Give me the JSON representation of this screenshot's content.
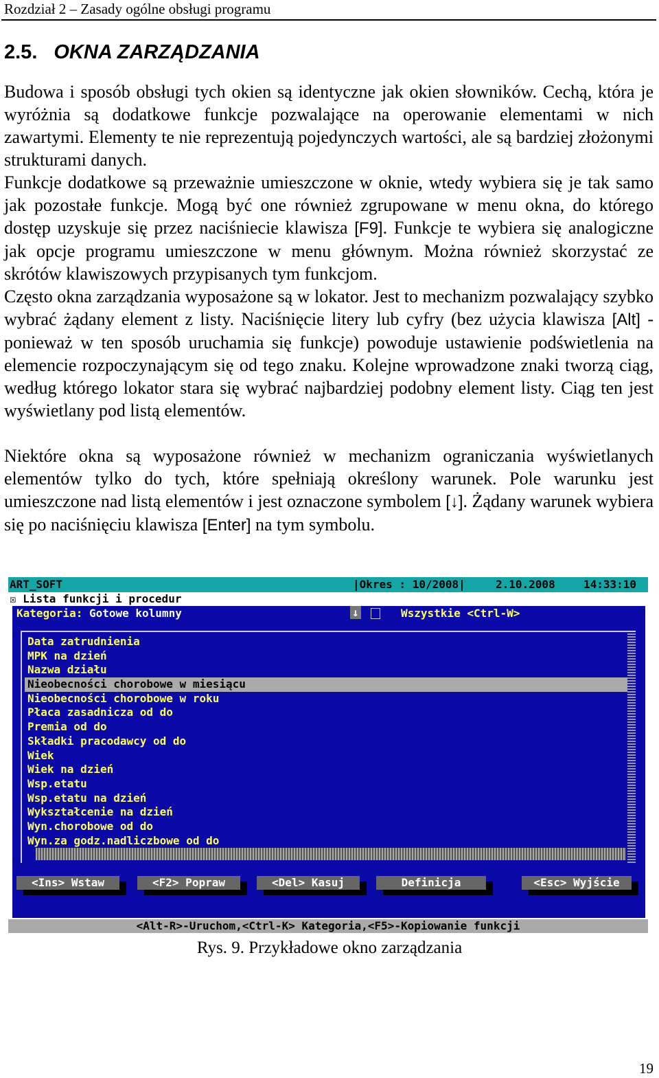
{
  "running_head": "Rozdział 2 – Zasady ogólne obsługi programu",
  "heading": {
    "number": "2.5.",
    "title": "OKNA ZARZĄDZANIA"
  },
  "paragraphs": [
    [
      {
        "t": "Budowa i sposób obsługi tych okien są identyczne jak okien słowników. Cechą, która je wyróżnia są dodatkowe funkcje pozwalające na operowanie elementami w nich zawartymi. Elementy te nie reprezentują pojedynczych wartości, ale są bardziej złożonymi strukturami danych."
      }
    ],
    [
      {
        "t": "Funkcje dodatkowe są przeważnie umieszczone w oknie, wtedy wybiera się je tak samo jak pozostałe funkcje. Mogą być one również zgrupowane w menu okna, do którego dostęp uzyskuje się przez naciśniecie klawisza "
      },
      {
        "k": "[F9]"
      },
      {
        "t": ". Funkcje te wybiera się analogiczne jak opcje programu umieszczone w menu głównym. Można również skorzystać ze skrótów klawiszowych przypisanych tym funkcjom."
      }
    ],
    [
      {
        "t": "Często okna zarządzania wyposażone są w lokator. Jest to mechanizm pozwalający szybko wybrać żądany element z listy. Naciśnięcie litery lub cyfry (bez użycia klawisza "
      },
      {
        "k": "[Alt]"
      },
      {
        "t": " - ponieważ w ten sposób uruchamia się funkcje) powoduje ustawienie podświetlenia na elemencie rozpoczynającym się od tego znaku. Kolejne wprowadzone znaki tworzą ciąg, według którego lokator stara się wybrać najbardziej podobny element listy. Ciąg ten jest wyświetlany pod listą elementów."
      }
    ],
    [
      {
        "t": "Niektóre okna są wyposażone również w mechanizm ograniczania wyświetlanych elementów tylko do tych, które spełniają określony warunek. Pole warunku jest umieszczone nad listą elementów i jest oznaczone symbolem "
      },
      {
        "k": "[↓]"
      },
      {
        "t": ". Żądany warunek wybiera się po naciśnięciu klawisza "
      },
      {
        "k": "[Enter]"
      },
      {
        "t": " na tym symbolu."
      }
    ]
  ],
  "screen": {
    "app": "ART_SOFT",
    "period": "|Okres : 10/2008|",
    "date": "2.10.2008",
    "time": "14:33:10",
    "window_title": "☒ Lista funkcji i procedur",
    "category_label": "Kategoria:",
    "category_value": "Gotowe kolumny",
    "filter_arrow": "↓",
    "filter_all": "Wszystkie <Ctrl-W>",
    "items": [
      "Data zatrudnienia",
      "MPK na dzień",
      "Nazwa działu",
      "Nieobecności chorobowe w miesiącu",
      "Nieobecności chorobowe w roku",
      "Płaca zasadnicza od do",
      "Premia od do",
      "Składki pracodawcy od do",
      "Wiek",
      "Wiek na dzień",
      "Wsp.etatu",
      "Wsp.etatu na dzień",
      "Wykształcenie na dzień",
      "Wyn.chorobowe od do",
      "Wyn.za godz.nadliczbowe od do"
    ],
    "selected_index": 3,
    "buttons": [
      "<Ins> Wstaw",
      "<F2> Popraw",
      "<Del> Kasuj",
      "Definicja",
      "<Esc> Wyjście"
    ],
    "status": "<Alt-R>-Uruchom,<Ctrl-K> Kategoria,<F5>-Kopiowanie funkcji",
    "colors": {
      "title_bar": "#14a6a6",
      "window": "#0a0aa8",
      "hotkey": "#ffff55",
      "selection": "#aaaaaa"
    }
  },
  "caption": "Rys. 9. Przykładowe okno zarządzania",
  "page_number": "19"
}
